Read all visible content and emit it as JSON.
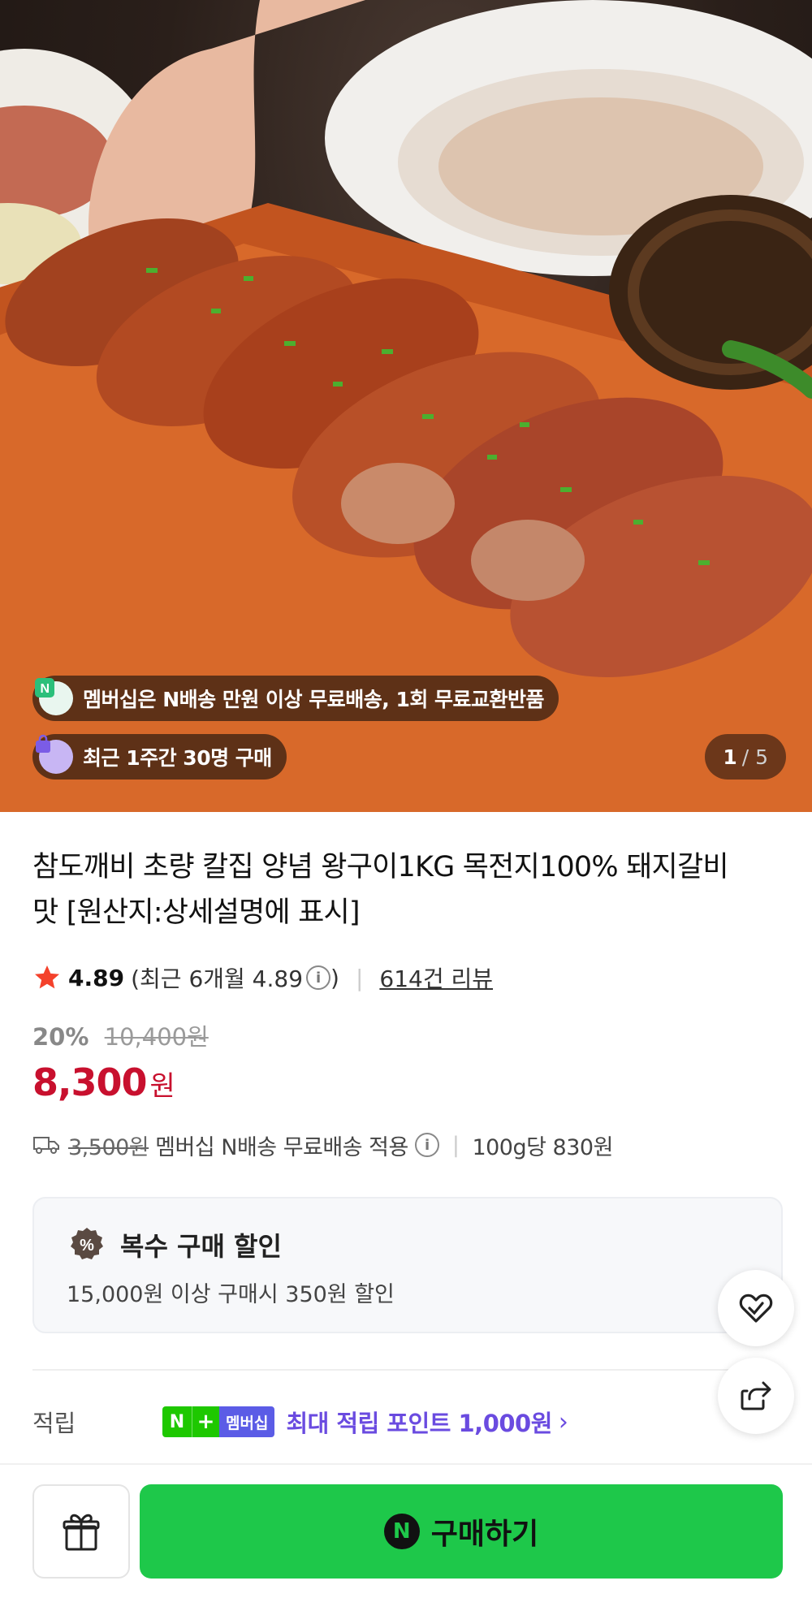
{
  "hero": {
    "membership_banner": "멤버십은 N배송 만원 이상 무료배송, 1회 무료교환반품",
    "recent_buyers_banner": "최근 1주간 30명 구매",
    "image_counter_current": "1",
    "image_counter_total": "/ 5"
  },
  "product": {
    "title": "참도깨비 초량 칼집 양념 왕구이1KG 목전지100% 돼지갈비 맛 [원산지:상세설명에 표시]",
    "rating": "4.89",
    "rating_recent": "(최근 6개월 4.89",
    "rating_recent_close": ")",
    "reviews": "614건 리뷰",
    "discount_pct": "20%",
    "original_price": "10,400원",
    "price": "8,300",
    "price_unit": "원",
    "shipping_fee": "3,500원",
    "shipping_text": "멤버십 N배송 무료배송 적용",
    "unit_price": "100g당 830원"
  },
  "bulk_discount": {
    "title": "복수 구매 할인",
    "description": "15,000원 이상 구매시 350원 할인",
    "badge_symbol": "%"
  },
  "points": {
    "label": "적립",
    "n_label": "N",
    "plus_label": "+",
    "membership_label": "멤버십",
    "text": "최대 적립 포인트 1,000원",
    "chevron": "›"
  },
  "bottom_bar": {
    "buy_label": "구매하기",
    "buy_n": "N"
  },
  "colors": {
    "price_red": "#c8102e",
    "buy_green": "#1ec84a",
    "points_purple": "#6a4be0",
    "naver_green": "#1ec800"
  },
  "icons": [
    "star-icon",
    "info-icon",
    "truck-icon",
    "percent-badge-icon",
    "wishlist-heart-icon",
    "share-icon",
    "gift-icon",
    "naver-n-icon"
  ]
}
